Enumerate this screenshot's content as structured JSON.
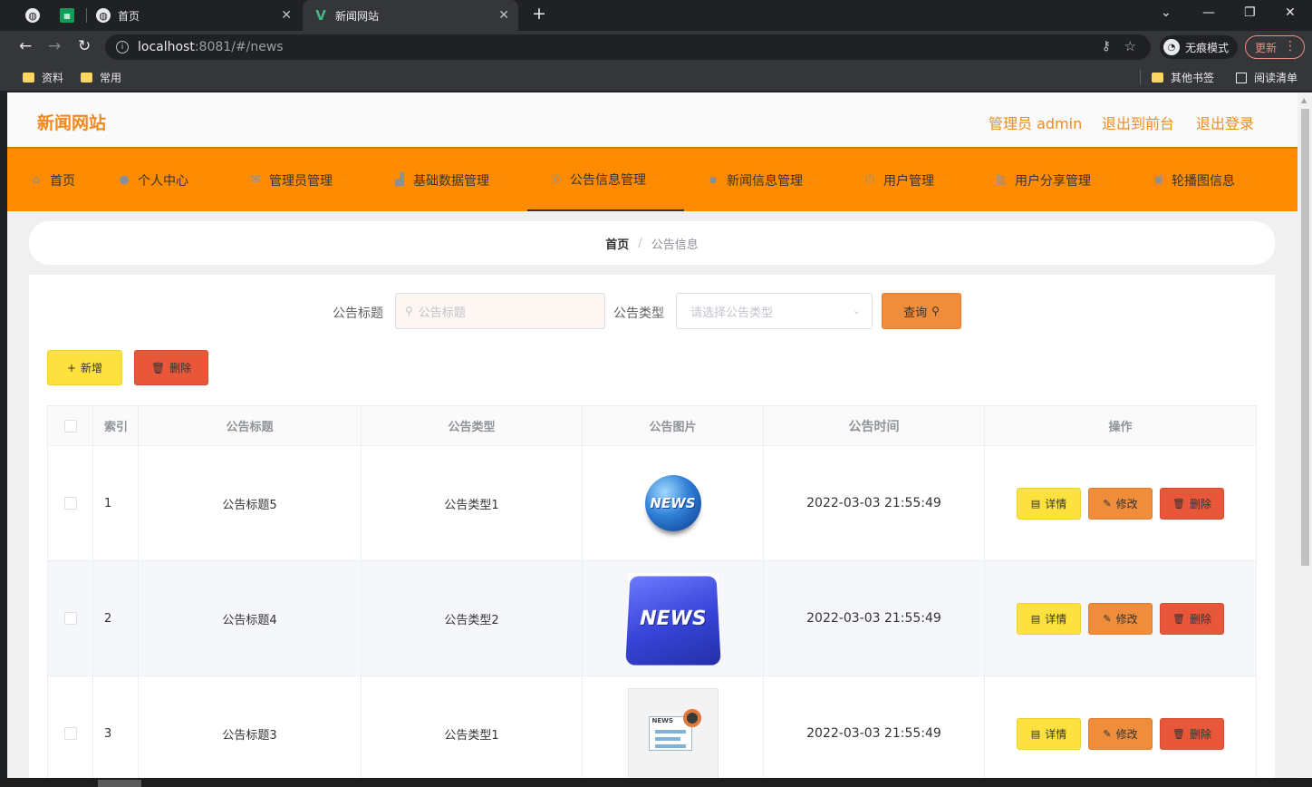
{
  "browser": {
    "tabs": [
      {
        "title": "",
        "icon": "globe-icon"
      },
      {
        "title": "",
        "icon": "sheets-icon"
      },
      {
        "title": "首页",
        "icon": "globe-icon"
      },
      {
        "title": "新闻网站",
        "icon": "vue-icon"
      }
    ],
    "url_host": "localhost",
    "url_path": ":8081/#/news",
    "incognito_label": "无痕模式",
    "update_label": "更新",
    "bookmarks": [
      "资料",
      "常用"
    ],
    "other_bookmarks": "其他书签",
    "reading_list": "阅读清单"
  },
  "site": {
    "title": "新闻网站",
    "admin_label": "管理员 admin",
    "to_front": "退出到前台",
    "logout": "退出登录"
  },
  "nav": [
    {
      "label": "首页",
      "icon": "home-icon"
    },
    {
      "label": "个人中心",
      "icon": "user-icon"
    },
    {
      "label": "管理员管理",
      "icon": "mail-icon"
    },
    {
      "label": "基础数据管理",
      "icon": "chart-icon"
    },
    {
      "label": "公告信息管理",
      "icon": "circle-icon"
    },
    {
      "label": "新闻信息管理",
      "icon": "chat-icon"
    },
    {
      "label": "用户管理",
      "icon": "power-icon"
    },
    {
      "label": "用户分享管理",
      "icon": "grid-icon"
    },
    {
      "label": "轮播图信息",
      "icon": "picture-icon"
    }
  ],
  "breadcrumb": {
    "home": "首页",
    "separator": "/",
    "current": "公告信息"
  },
  "search": {
    "title_label": "公告标题",
    "title_placeholder": "公告标题",
    "type_label": "公告类型",
    "type_placeholder": "请选择公告类型",
    "query_label": "查询"
  },
  "actions": {
    "add_label": "新增",
    "delete_label": "删除"
  },
  "table": {
    "headers": {
      "index": "索引",
      "title": "公告标题",
      "type": "公告类型",
      "picture": "公告图片",
      "time": "公告时间",
      "ops": "操作"
    },
    "op_labels": {
      "detail": "详情",
      "edit": "修改",
      "delete": "删除"
    },
    "rows": [
      {
        "index": "1",
        "title": "公告标题5",
        "type": "公告类型1",
        "picture_text": "NEWS",
        "time": "2022-03-03 21:55:49"
      },
      {
        "index": "2",
        "title": "公告标题4",
        "type": "公告类型2",
        "picture_text": "NEWS",
        "time": "2022-03-03 21:55:49"
      },
      {
        "index": "3",
        "title": "公告标题3",
        "type": "公告类型1",
        "picture_text": "NEWS",
        "time": "2022-03-03 21:55:49"
      }
    ]
  },
  "colors": {
    "nav_bg": "#ff8c00",
    "accent": "#ef8a1e",
    "yellow_btn": "#fde13e",
    "orange_btn": "#f08d3b",
    "red_btn": "#e8573a"
  }
}
